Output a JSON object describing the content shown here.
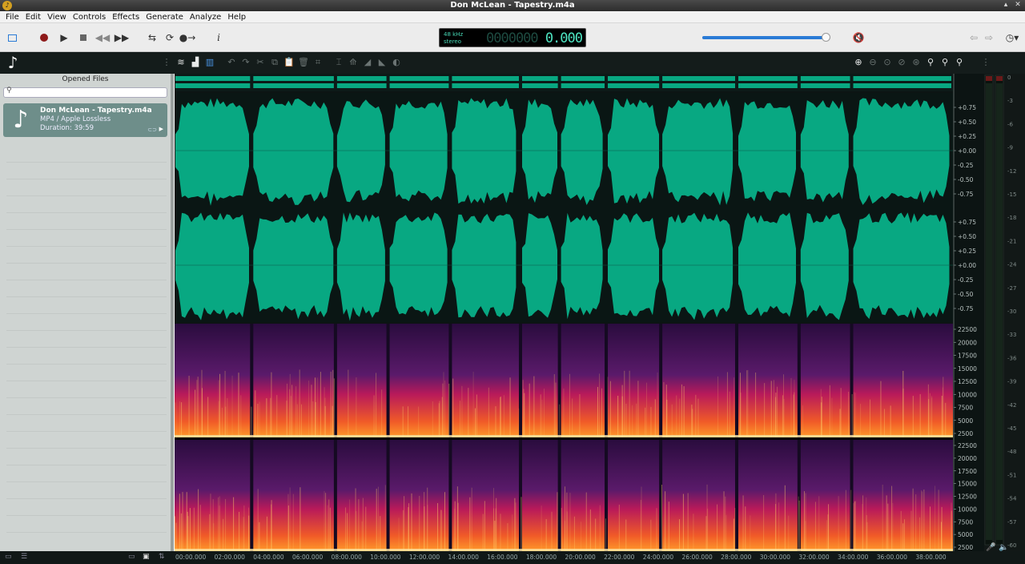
{
  "window": {
    "title": "Don McLean - Tapestry.m4a"
  },
  "menu": [
    "File",
    "Edit",
    "View",
    "Controls",
    "Effects",
    "Generate",
    "Analyze",
    "Help"
  ],
  "transport": {
    "sample_rate": "48 kHz",
    "channels": "stereo",
    "position_dim": "0000000",
    "position": "0.000",
    "volume_fraction": 0.96
  },
  "sidebar": {
    "header": "Opened Files",
    "search_placeholder": "",
    "files": [
      {
        "name": "Don McLean - Tapestry.m4a",
        "format": "MP4 / Apple Lossless",
        "duration": "Duration: 39:59"
      }
    ]
  },
  "waveform": {
    "amplitude_ticks": [
      "+0.75",
      "+0.50",
      "+0.25",
      "+0.00",
      "-0.25",
      "-0.50",
      "-0.75"
    ],
    "freq_ticks": [
      "22500",
      "20000",
      "17500",
      "15000",
      "12500",
      "10000",
      "7500",
      "5000",
      "2500"
    ],
    "song_boundaries_min": [
      0,
      4.0,
      8.3,
      11.0,
      14.2,
      17.8,
      19.8,
      22.2,
      25.0,
      28.9,
      32.1,
      34.8,
      40
    ],
    "colors": {
      "wave": "#08a882",
      "wave_bg": "#0a1614",
      "spec_low": "#2a0c3e",
      "spec_mid": "#b81a5a",
      "spec_high": "#ff9a2a"
    }
  },
  "meter": {
    "db_ticks": [
      "0",
      "-3",
      "-6",
      "-9",
      "-12",
      "-15",
      "-18",
      "-21",
      "-24",
      "-27",
      "-30",
      "-33",
      "-36",
      "-39",
      "-42",
      "-45",
      "-48",
      "-51",
      "-54",
      "-57",
      "-60"
    ]
  },
  "timeline": {
    "labels": [
      "00:00.000",
      "02:00.000",
      "04:00.000",
      "06:00.000",
      "08:00.000",
      "10:00.000",
      "12:00.000",
      "14:00.000",
      "16:00.000",
      "18:00.000",
      "20:00.000",
      "22:00.000",
      "24:00.000",
      "26:00.000",
      "28:00.000",
      "30:00.000",
      "32:00.000",
      "34:00.000",
      "36:00.000",
      "38:00.000"
    ]
  },
  "icons": {
    "toolbar": [
      "view-toggle-icon",
      "record-icon",
      "play-icon",
      "stop-icon",
      "rewind-icon",
      "fast-forward-icon",
      "loop-icon",
      "repeat-icon",
      "skip-icon",
      "info-icon",
      "mute-icon",
      "back-icon",
      "forward-icon",
      "history-icon"
    ]
  }
}
